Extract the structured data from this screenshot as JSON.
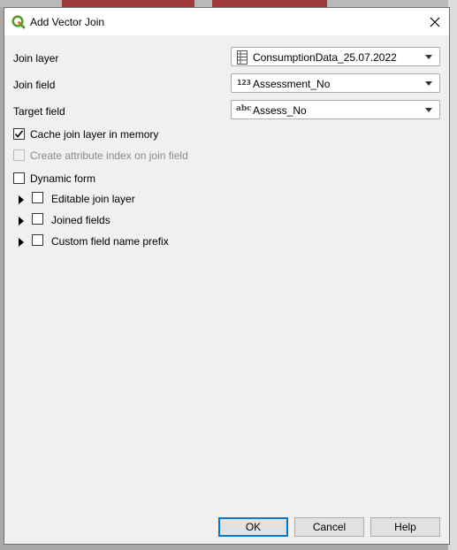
{
  "dialog": {
    "title": "Add Vector Join",
    "close_label": "✕"
  },
  "fields": {
    "join_layer": {
      "label": "Join layer",
      "value": "ConsumptionData_25.07.2022",
      "icon": "table-icon"
    },
    "join_field": {
      "label": "Join field",
      "value": "Assessment_No",
      "icon": "integer-field-icon",
      "badge": "123"
    },
    "target_field": {
      "label": "Target field",
      "value": "Assess_No",
      "icon": "text-field-icon",
      "badge": "abc"
    }
  },
  "options": {
    "cache": {
      "label": "Cache join layer in memory",
      "checked": true,
      "enabled": true
    },
    "attr_index": {
      "label": "Create attribute index on join field",
      "checked": false,
      "enabled": false
    },
    "dynamic_form": {
      "label": "Dynamic form",
      "checked": false,
      "enabled": true
    }
  },
  "groups": [
    {
      "label": "Editable join layer",
      "checked": false
    },
    {
      "label": "Joined fields",
      "checked": false
    },
    {
      "label": "Custom field name prefix",
      "checked": false
    }
  ],
  "buttons": {
    "ok": "OK",
    "cancel": "Cancel",
    "help": "Help"
  },
  "colors": {
    "accent": "#0078d7",
    "qgis_green": "#589632",
    "qgis_yellow": "#ee7913"
  }
}
